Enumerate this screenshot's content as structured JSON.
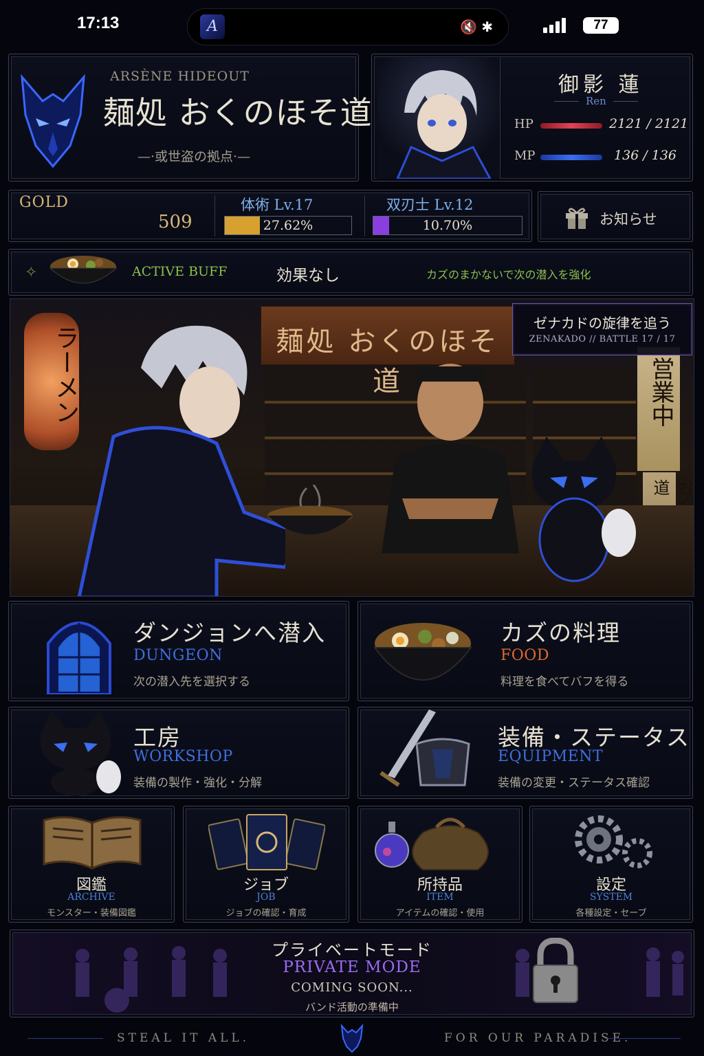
{
  "status_bar": {
    "time": "17:13",
    "battery": "77",
    "island_logo": "A"
  },
  "hideout": {
    "subtitle": "ARSÈNE HIDEOUT",
    "title": "麺処 おくのほそ道",
    "caption": "—·或世盗の拠点·—"
  },
  "character": {
    "name": "御影 蓮",
    "name_romaji": "Ren",
    "hp_label": "HP",
    "hp_value": "2121 / 2121",
    "hp_fraction": 1.0,
    "mp_label": "MP",
    "mp_value": "136 / 136",
    "mp_fraction": 1.0
  },
  "resources": {
    "gold_label": "GOLD",
    "gold_value": "509",
    "jobs": [
      {
        "title": "体術 Lv.17",
        "progress_text": "27.62%",
        "progress": 0.2762,
        "color": "#d6a12e"
      },
      {
        "title": "双刃士 Lv.12",
        "progress_text": "10.70%",
        "progress": 0.107,
        "color": "#8b3ee0"
      }
    ],
    "notice_label": "お知らせ"
  },
  "buff": {
    "label": "ACTIVE BUFF",
    "value": "効果なし",
    "description": "カズのまかないで次の潜入を強化"
  },
  "scene": {
    "sign_banner": "麺処 おくのほそ道",
    "lantern_text": "ラーメン",
    "open_sign": "営業中",
    "side_sign": "おくのほそ道",
    "quest_title": "ゼナカドの旋律を追う",
    "quest_sub": "ZENAKADO // BATTLE 17 / 17"
  },
  "menu": {
    "dungeon": {
      "title": "ダンジョンへ潜入",
      "en": "DUNGEON",
      "desc": "次の潜入先を選択する"
    },
    "food": {
      "title": "カズの料理",
      "en": "FOOD",
      "desc": "料理を食べてバフを得る"
    },
    "workshop": {
      "title": "工房",
      "en": "WORKSHOP",
      "desc": "装備の製作・強化・分解"
    },
    "equipment": {
      "title": "装備・ステータス",
      "en": "EQUIPMENT",
      "desc": "装備の変更・ステータス確認"
    },
    "archive": {
      "title": "図鑑",
      "en": "ARCHIVE",
      "desc": "モンスター・装備図鑑"
    },
    "job": {
      "title": "ジョブ",
      "en": "JOB",
      "desc": "ジョブの確認・育成"
    },
    "item": {
      "title": "所持品",
      "en": "ITEM",
      "desc": "アイテムの確認・使用"
    },
    "system": {
      "title": "設定",
      "en": "SYSTEM",
      "desc": "各種設定・セーブ"
    }
  },
  "private_mode": {
    "title": "プライベートモード",
    "en": "PRIVATE MODE",
    "soon": "COMING SOON...",
    "desc": "バンド活動の準備中"
  },
  "footer": {
    "left": "STEAL IT ALL.",
    "right": "FOR OUR PARADISE."
  },
  "colors": {
    "accent_blue": "#3f6fe0",
    "accent_gold": "#d7b878",
    "buff_green": "#8cbf4e",
    "private_purple": "#9b6cf0",
    "food_orange": "#e0682c"
  }
}
